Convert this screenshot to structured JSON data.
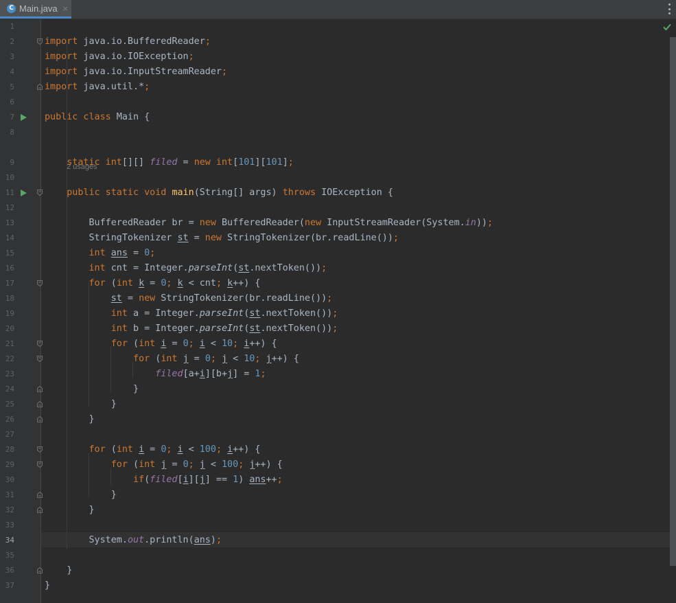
{
  "tab": {
    "title": "Main.java",
    "icon": "java-class-icon",
    "close": "×"
  },
  "toolbar": {
    "more_icon": "vertical-ellipsis-icon"
  },
  "inlay_hint": "2 usages",
  "status": {
    "inspection_icon": "check-icon",
    "color": "#59a869"
  },
  "editor": {
    "current_line": 34,
    "lines": [
      {
        "n": "1",
        "code": ""
      },
      {
        "n": "2",
        "code": "<span class='k'>import</span> java.io.BufferedReader<span class='k'>;</span>"
      },
      {
        "n": "3",
        "code": "<span class='k'>import</span> java.io.IOException<span class='k'>;</span>"
      },
      {
        "n": "4",
        "code": "<span class='k'>import</span> java.io.InputStreamReader<span class='k'>;</span>"
      },
      {
        "n": "5",
        "code": "<span class='k'>import</span> java.util.*<span class='k'>;</span>"
      },
      {
        "n": "6",
        "code": ""
      },
      {
        "n": "7",
        "code": "<span class='k'>public class</span> Main {"
      },
      {
        "n": "8",
        "code": ""
      },
      {
        "n": "9",
        "code": "    <span class='k'>static int</span>[][] <span class='f'>filed</span> = <span class='k'>new int</span>[<span class='n'>101</span>][<span class='n'>101</span>]<span class='k'>;</span>"
      },
      {
        "n": "10",
        "code": ""
      },
      {
        "n": "11",
        "code": "    <span class='k'>public static void</span> <span class='m'>main</span>(String[] args) <span class='k'>throws</span> IOException {"
      },
      {
        "n": "12",
        "code": ""
      },
      {
        "n": "13",
        "code": "        BufferedReader br = <span class='k'>new</span> BufferedReader(<span class='k'>new</span> InputStreamReader(System.<span class='f'>in</span>))<span class='k'>;</span>"
      },
      {
        "n": "14",
        "code": "        StringTokenizer <span class='u'>st</span> = <span class='k'>new</span> StringTokenizer(br.readLine())<span class='k'>;</span>"
      },
      {
        "n": "15",
        "code": "        <span class='k'>int</span> <span class='u'>ans</span> = <span class='n'>0</span><span class='k'>;</span>"
      },
      {
        "n": "16",
        "code": "        <span class='k'>int</span> cnt = Integer.<span class='s'>parseInt</span>(<span class='u'>st</span>.nextToken())<span class='k'>;</span>"
      },
      {
        "n": "17",
        "code": "        <span class='k'>for</span> (<span class='k'>int</span> <span class='u'>k</span> = <span class='n'>0</span><span class='k'>;</span> <span class='u'>k</span> &lt; cnt<span class='k'>;</span> <span class='u'>k</span>++) {"
      },
      {
        "n": "18",
        "code": "            <span class='u'>st</span> = <span class='k'>new</span> StringTokenizer(br.readLine())<span class='k'>;</span>"
      },
      {
        "n": "19",
        "code": "            <span class='k'>int</span> a = Integer.<span class='s'>parseInt</span>(<span class='u'>st</span>.nextToken())<span class='k'>;</span>"
      },
      {
        "n": "20",
        "code": "            <span class='k'>int</span> b = Integer.<span class='s'>parseInt</span>(<span class='u'>st</span>.nextToken())<span class='k'>;</span>"
      },
      {
        "n": "21",
        "code": "            <span class='k'>for</span> (<span class='k'>int</span> <span class='u'>i</span> = <span class='n'>0</span><span class='k'>;</span> <span class='u'>i</span> &lt; <span class='n'>10</span><span class='k'>;</span> <span class='u'>i</span>++) {"
      },
      {
        "n": "22",
        "code": "                <span class='k'>for</span> (<span class='k'>int</span> <span class='u'>j</span> = <span class='n'>0</span><span class='k'>;</span> <span class='u'>j</span> &lt; <span class='n'>10</span><span class='k'>;</span> <span class='u'>j</span>++) {"
      },
      {
        "n": "23",
        "code": "                    <span class='f'>filed</span>[a+<span class='u'>i</span>][b+<span class='u'>j</span>] = <span class='n'>1</span><span class='k'>;</span>"
      },
      {
        "n": "24",
        "code": "                }"
      },
      {
        "n": "25",
        "code": "            }"
      },
      {
        "n": "26",
        "code": "        }"
      },
      {
        "n": "27",
        "code": ""
      },
      {
        "n": "28",
        "code": "        <span class='k'>for</span> (<span class='k'>int</span> <span class='u'>i</span> = <span class='n'>0</span><span class='k'>;</span> <span class='u'>i</span> &lt; <span class='n'>100</span><span class='k'>;</span> <span class='u'>i</span>++) {"
      },
      {
        "n": "29",
        "code": "            <span class='k'>for</span> (<span class='k'>int</span> <span class='u'>j</span> = <span class='n'>0</span><span class='k'>;</span> <span class='u'>j</span> &lt; <span class='n'>100</span><span class='k'>;</span> <span class='u'>j</span>++) {"
      },
      {
        "n": "30",
        "code": "                <span class='k'>if</span>(<span class='f'>filed</span>[<span class='u'>i</span>][<span class='u'>j</span>] == <span class='n'>1</span>) <span class='u'>ans</span>++<span class='k'>;</span>"
      },
      {
        "n": "31",
        "code": "            }"
      },
      {
        "n": "32",
        "code": "        }"
      },
      {
        "n": "33",
        "code": ""
      },
      {
        "n": "34",
        "code": "        System.<span class='f'>out</span>.println(<span class='u'>ans</span>)<span class='k'>;</span>"
      },
      {
        "n": "35",
        "code": ""
      },
      {
        "n": "36",
        "code": "    }"
      },
      {
        "n": "37",
        "code": "}"
      }
    ]
  }
}
